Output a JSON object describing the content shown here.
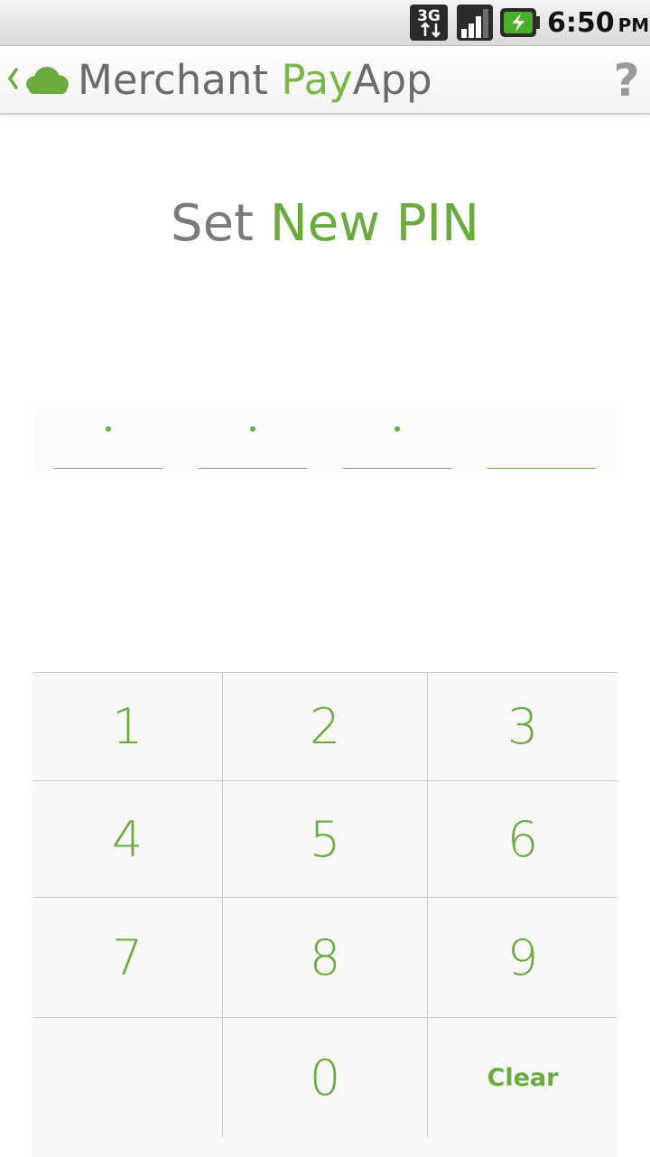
{
  "status_bar": {
    "network": "3G",
    "time": "6:50",
    "ampm": "PM",
    "icons": [
      "3g-icon",
      "signal-icon",
      "battery-charging-icon"
    ]
  },
  "action_bar": {
    "title_part1": "Merchant ",
    "title_part2": "Pay",
    "title_part3": "App",
    "help": "?",
    "icons": [
      "back-chevron-icon",
      "cloud-logo-icon",
      "help-icon"
    ]
  },
  "screen": {
    "title_prefix": "Set ",
    "title_accent": "New PIN"
  },
  "pin": {
    "slots": [
      {
        "filled": true
      },
      {
        "filled": true
      },
      {
        "filled": true
      },
      {
        "filled": false
      }
    ]
  },
  "keypad": {
    "keys": [
      "1",
      "2",
      "3",
      "4",
      "5",
      "6",
      "7",
      "8",
      "9",
      "",
      "0",
      "Clear"
    ]
  },
  "colors": {
    "accent": "#6aab3e",
    "text_gray": "#7a7a7a"
  }
}
